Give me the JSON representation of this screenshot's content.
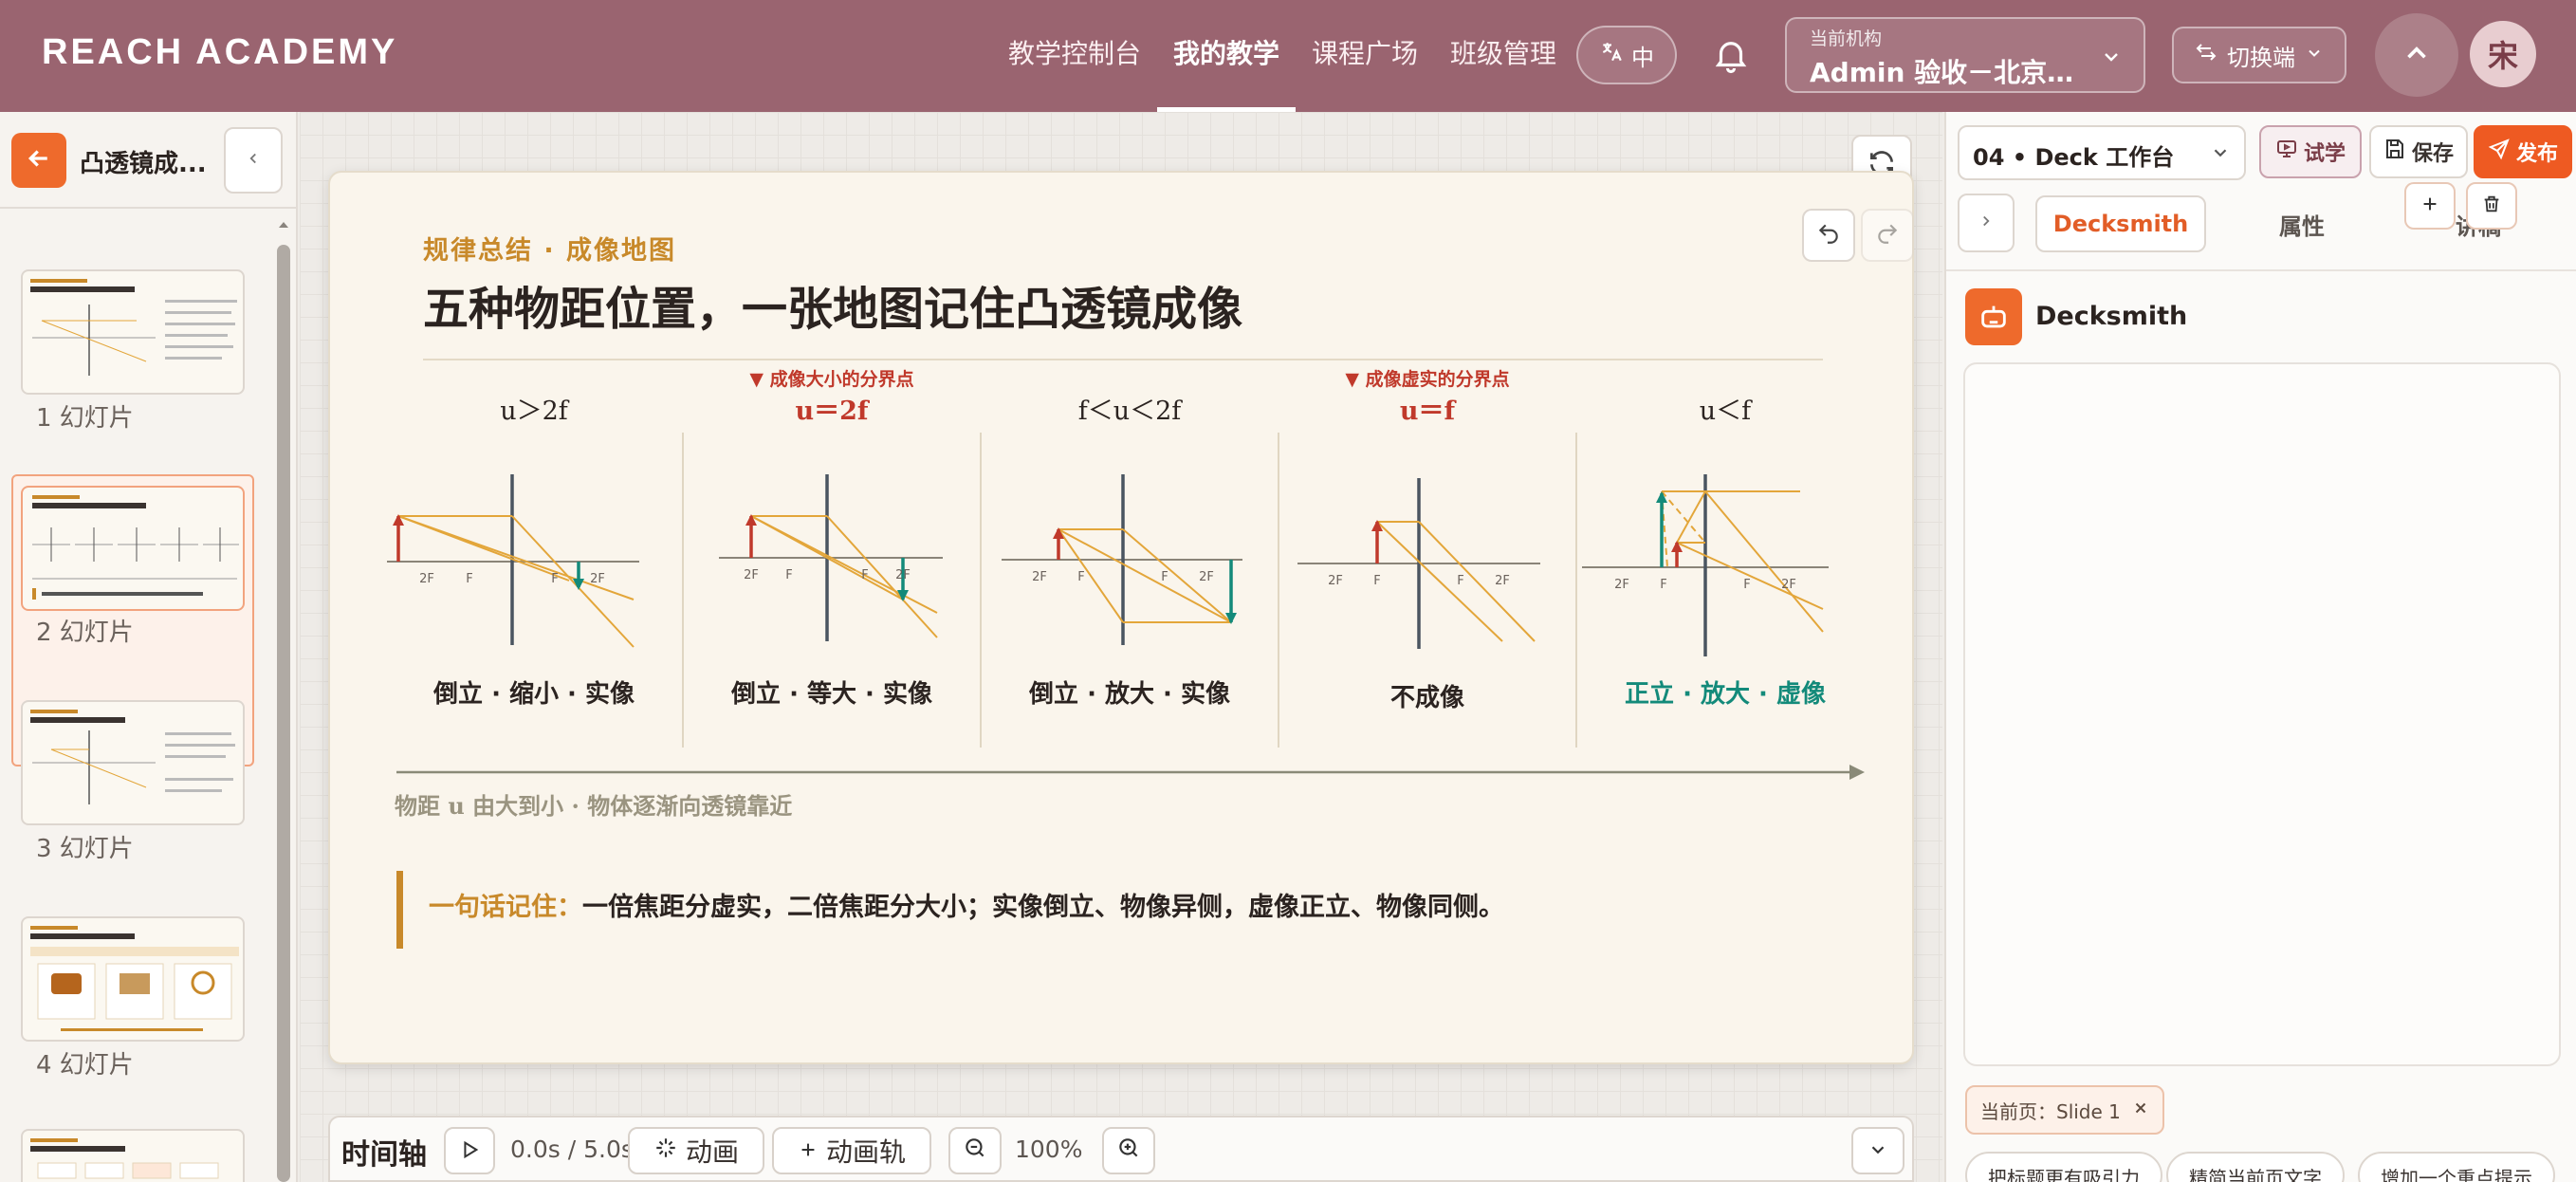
{
  "header": {
    "logo": "REACH ACADEMY",
    "nav": [
      "教学控制台",
      "我的教学",
      "课程广场",
      "班级管理"
    ],
    "active_nav": 1,
    "lang_label": "中",
    "org_label": "当前机构",
    "org_name": "Admin 验收－北京…",
    "switch_label": "切换端",
    "avatar_text": "宋"
  },
  "left": {
    "deck_title": "凸透镜成...",
    "slides": [
      {
        "label": "1  幻灯片"
      },
      {
        "label": "2  幻灯片"
      },
      {
        "label": "3  幻灯片"
      },
      {
        "label": "4  幻灯片"
      }
    ],
    "selected_slide": 2
  },
  "slide": {
    "kicker": "规律总结 · 成像地图",
    "title": "五种物距位置，一张地图记住凸透镜成像",
    "columns": [
      {
        "note": "",
        "condition": "u＞2f",
        "result": "倒立 · 缩小 · 实像"
      },
      {
        "note": "▼ 成像大小的分界点",
        "condition": "u＝2f",
        "result": "倒立 · 等大 · 实像"
      },
      {
        "note": "",
        "condition": "f＜u＜2f",
        "result": "倒立 · 放大 · 实像"
      },
      {
        "note": "▼ 成像虚实的分界点",
        "condition": "u＝f",
        "result": "不成像"
      },
      {
        "note": "",
        "condition": "u＜f",
        "result": "正立 · 放大 · 虚像"
      }
    ],
    "focus_labels": {
      "two_f": "2F",
      "f": "F"
    },
    "arrow_caption": "物距 u 由大到小 · 物体逐渐向透镜靠近",
    "quote_highlight": "一句话记住：",
    "quote_text": "一倍焦距分虚实，二倍焦距分大小；实像倒立、物像异侧，虚像正立、物像同侧。",
    "colors": {
      "accent": "#c8892a",
      "boundary": "#c0392b",
      "virtual": "#138a7a",
      "ray": "#e3a63a",
      "object": "#c0392b",
      "image_real": "#138a7a"
    }
  },
  "timeline": {
    "label": "时间轴",
    "time": "0.0s / 5.0s",
    "animation": "动画",
    "animation_track": "动画轨",
    "zoom": "100%"
  },
  "right": {
    "workspace": "04 • Deck 工作台",
    "try_label": "试学",
    "save_label": "保存",
    "publish_label": "发布",
    "tabs": [
      "Decksmith",
      "属性",
      "讲稿"
    ],
    "active_tab": 0,
    "assistant_name": "Decksmith",
    "current_page_chip": "当前页：Slide 1",
    "suggestions": [
      "把标题更有吸引力",
      "精简当前页文字",
      "增加一个重点提示"
    ]
  },
  "icons": {
    "lang": "translate-icon",
    "bell": "bell-icon",
    "org_dropdown": "chevron-down-icon",
    "switch": "swap-icon",
    "up": "chevron-up-icon",
    "back": "arrow-left-icon",
    "collapse": "chevron-left-icon",
    "refresh": "refresh-icon",
    "undo": "undo-icon",
    "redo": "redo-icon",
    "play": "play-icon",
    "animation": "sparkle-icon",
    "add": "plus-icon",
    "zoom_out": "zoom-out-icon",
    "zoom_in": "zoom-in-icon",
    "timeline_toggle": "chevron-down-icon",
    "try": "monitor-icon",
    "save": "save-icon",
    "publish": "send-icon",
    "expand": "chevron-right-icon",
    "assistant": "robot-icon",
    "delete": "trash-icon",
    "chip_close": "close-icon"
  }
}
